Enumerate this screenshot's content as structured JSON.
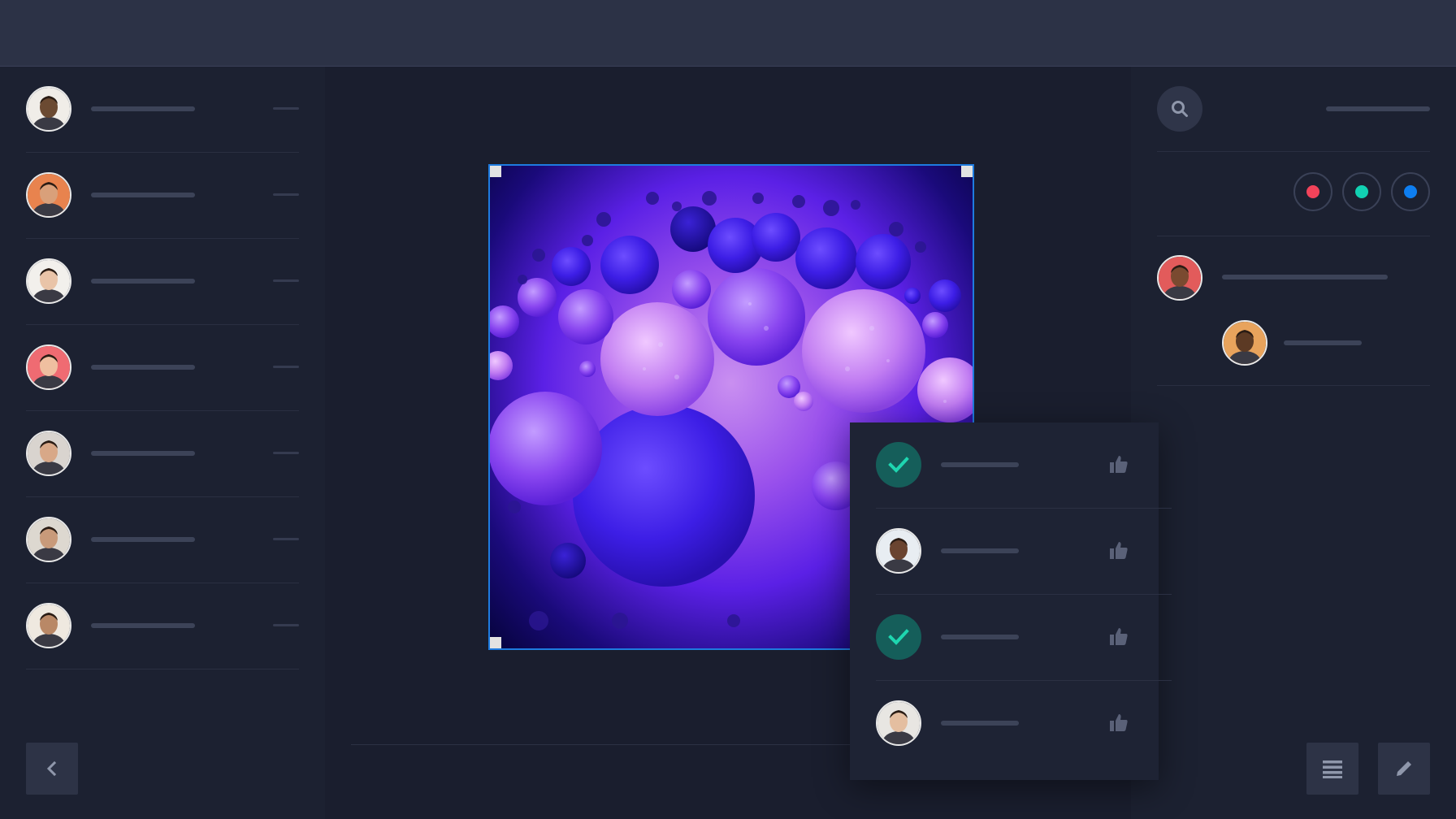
{
  "app": {
    "title": ""
  },
  "colors": {
    "background": "#1a1e2e",
    "panel": "#1c2131",
    "topbar": "#2c3246",
    "selection": "#1e7be0",
    "check_badge": "#155e5a",
    "check_mark": "#1ed6b0"
  },
  "contacts": [
    {
      "avatar": "avatar-person-1",
      "skin": "#6b4a32",
      "bg": "#f0ede8"
    },
    {
      "avatar": "avatar-person-2",
      "skin": "#d9a07a",
      "bg": "#e8834e"
    },
    {
      "avatar": "avatar-person-3",
      "skin": "#e9c4a8",
      "bg": "#f2f0ec"
    },
    {
      "avatar": "avatar-person-4",
      "skin": "#efbfa0",
      "bg": "#ef6b72"
    },
    {
      "avatar": "avatar-person-5",
      "skin": "#d8a888",
      "bg": "#d9d4cf"
    },
    {
      "avatar": "avatar-person-6",
      "skin": "#c89a7a",
      "bg": "#ddd8d0"
    },
    {
      "avatar": "avatar-person-7",
      "skin": "#b98866",
      "bg": "#efe9e0"
    }
  ],
  "canvas": {
    "image": "purple-bubbles-image"
  },
  "right_panel": {
    "search_icon": "search-icon",
    "swatches": [
      {
        "name": "red",
        "color": "#f2435a"
      },
      {
        "name": "teal",
        "color": "#11d1b2"
      },
      {
        "name": "blue",
        "color": "#0e7ef0"
      }
    ],
    "thread": [
      {
        "avatar": "avatar-commenter-1",
        "skin": "#7a4a30",
        "bg": "#e25b5b"
      },
      {
        "avatar": "avatar-commenter-2",
        "skin": "#5c3a24",
        "bg": "#e8a35c"
      }
    ]
  },
  "popup": {
    "rows": [
      {
        "kind": "check",
        "icon": "check-icon"
      },
      {
        "kind": "avatar",
        "avatar": "avatar-reviewer-1",
        "skin": "#6a4430",
        "bg": "#e8edf2"
      },
      {
        "kind": "check",
        "icon": "check-icon"
      },
      {
        "kind": "avatar",
        "avatar": "avatar-reviewer-2",
        "skin": "#e4bea0",
        "bg": "#e8e6e2"
      }
    ],
    "like_icon": "thumbs-up-icon"
  },
  "toolbar": {
    "back_icon": "chevron-left-icon",
    "list_icon": "list-icon",
    "edit_icon": "pencil-icon"
  }
}
